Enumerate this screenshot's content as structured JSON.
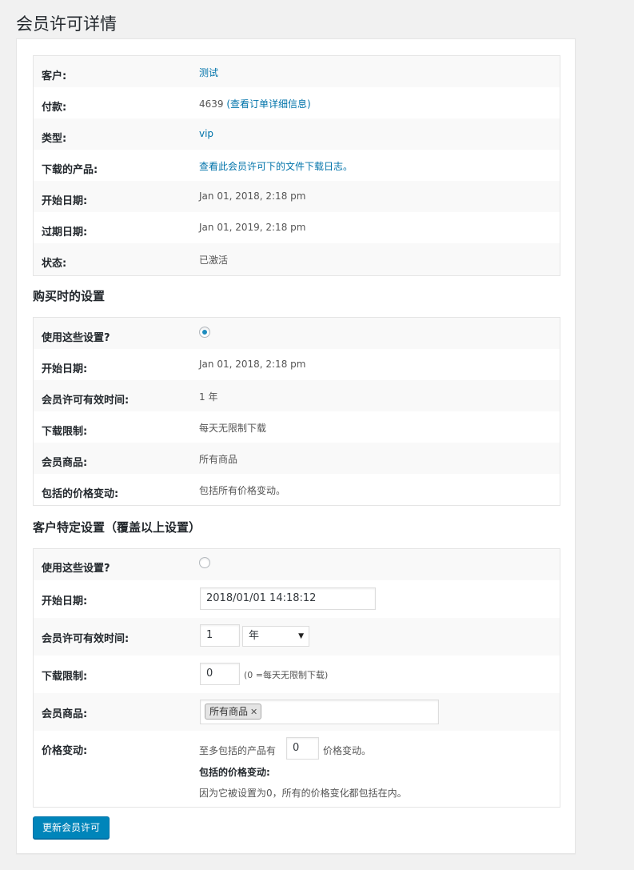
{
  "page_title": "会员许可详情",
  "details": {
    "rows": [
      {
        "label": "客户:",
        "value": "测试",
        "link": true
      },
      {
        "label": "付款:",
        "value_prefix": "4639 ",
        "value": "(查看订单详细信息)",
        "link": true
      },
      {
        "label": "类型:",
        "value": "vip",
        "link": true
      },
      {
        "label": "下载的产品:",
        "value": "查看此会员许可下的文件下载日志。",
        "link": true
      },
      {
        "label": "开始日期:",
        "value": "Jan 01, 2018, 2:18 pm"
      },
      {
        "label": "过期日期:",
        "value": "Jan 01, 2019, 2:18 pm"
      },
      {
        "label": "状态:",
        "value": "已激活"
      }
    ]
  },
  "purchase_settings": {
    "title": "购买时的设置",
    "rows": [
      {
        "label": "使用这些设置?",
        "radio_checked": true
      },
      {
        "label": "开始日期:",
        "value": "Jan 01, 2018, 2:18 pm"
      },
      {
        "label": "会员许可有效时间:",
        "value": "1 年"
      },
      {
        "label": "下载限制:",
        "value": "每天无限制下载"
      },
      {
        "label": "会员商品:",
        "value": "所有商品"
      },
      {
        "label": "包括的价格变动:",
        "value": "包括所有价格变动。"
      }
    ]
  },
  "customer_settings": {
    "title": "客户特定设置（覆盖以上设置）",
    "use_label": "使用这些设置?",
    "radio_checked": false,
    "start_date_label": "开始日期:",
    "start_date_value": "2018/01/01 14:18:12",
    "duration_label": "会员许可有效时间:",
    "duration_value": "1",
    "duration_unit": "年",
    "download_label": "下载限制:",
    "download_value": "0",
    "download_note": "(0 =每天无限制下载)",
    "products_label": "会员商品:",
    "products_tag": "所有商品",
    "variations_label": "价格变动:",
    "variations_prefix": "至多包括的产品有",
    "variations_value": "0",
    "variations_suffix": "价格变动。",
    "included_label": "包括的价格变动:",
    "included_note": "因为它被设置为0，所有的价格变化都包括在内。"
  },
  "submit_button": "更新会员许可",
  "colors": {
    "accent": "#0073aa",
    "button": "#0085ba",
    "radio_dot": "#1e8cbe"
  }
}
